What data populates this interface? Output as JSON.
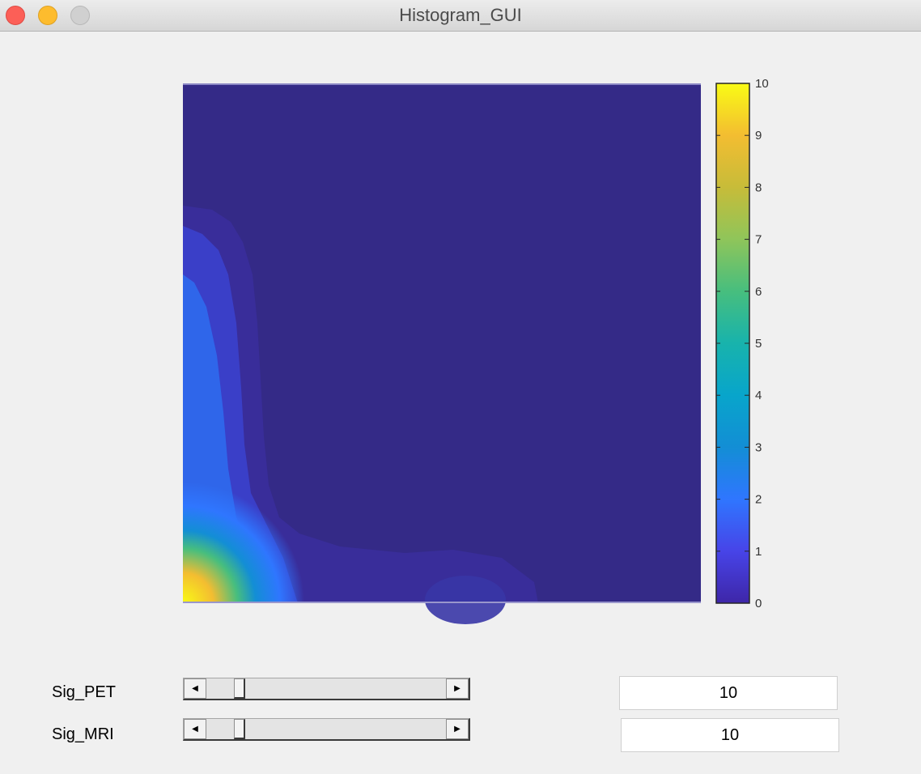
{
  "window": {
    "title": "Histogram_GUI"
  },
  "colors": {
    "titlebar": "#e4e4e4",
    "background": "#f0f0f0",
    "close": "#fc5f57",
    "minimize": "#fdbc2e",
    "maximize": "#d0d0d0",
    "colormap": [
      "#3e26a8",
      "#4744e8",
      "#2f76ff",
      "#138ed5",
      "#08a5cb",
      "#18b3ac",
      "#47be7e",
      "#8fc55a",
      "#c7bc39",
      "#f3bd31",
      "#f9fb15"
    ]
  },
  "chart_data": {
    "type": "heatmap",
    "colorbar": {
      "ticks": [
        "0",
        "1",
        "2",
        "3",
        "4",
        "5",
        "6",
        "7",
        "8",
        "9",
        "10"
      ],
      "clim": [
        0,
        10
      ]
    }
  },
  "controls": [
    {
      "label": "Sig_PET",
      "value": "10",
      "slider_fraction": 0.12
    },
    {
      "label": "Sig_MRI",
      "value": "10",
      "slider_fraction": 0.12
    }
  ]
}
